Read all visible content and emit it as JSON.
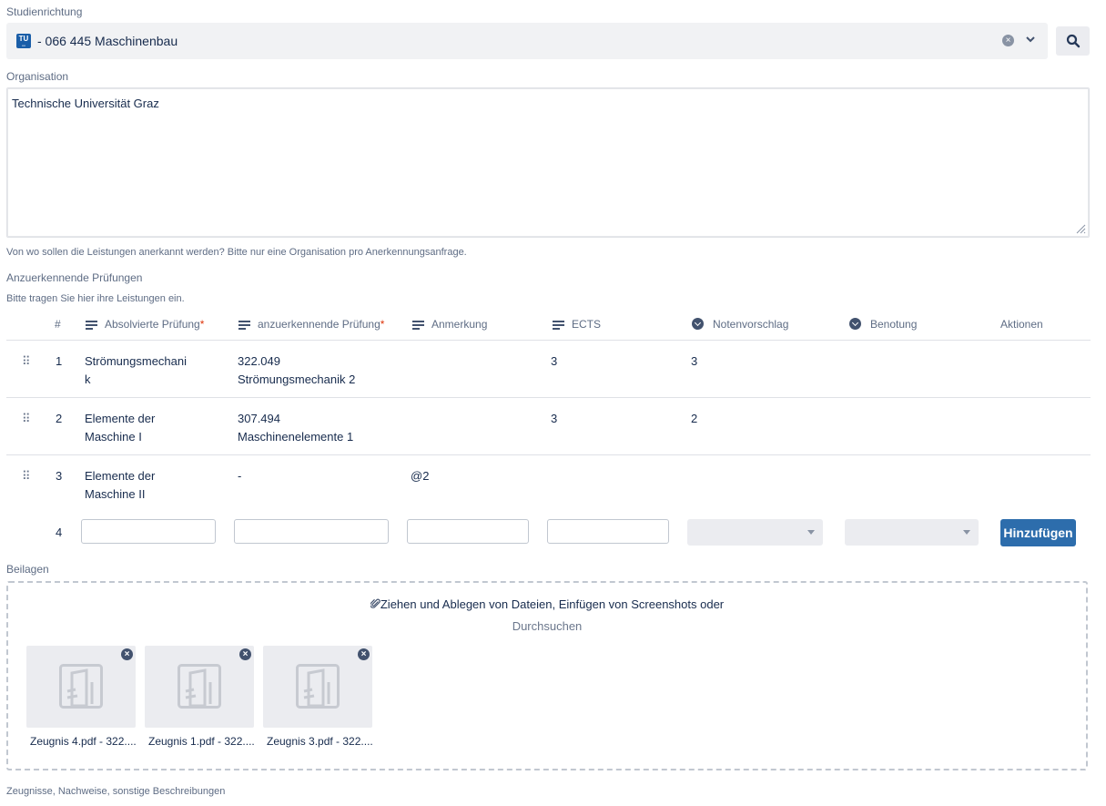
{
  "study": {
    "label": "Studienrichtung",
    "logo_text": "TU",
    "value": "- 066 445 Maschinenbau"
  },
  "organisation": {
    "label": "Organisation",
    "value": "Technische Universität Graz",
    "hint": "Von wo sollen die Leistungen anerkannt werden? Bitte nur eine Organisation pro Anerkennungsanfrage."
  },
  "exams": {
    "label": "Anzuerkennende Prüfungen",
    "hint": "Bitte tragen Sie hier ihre Leistungen ein.",
    "columns": {
      "num": "#",
      "absolved": "Absolvierte Prüfung",
      "recognized": "anzuerkennende Prüfung",
      "remark": "Anmerkung",
      "ects": "ECTS",
      "grade_suggestion": "Notenvorschlag",
      "grading": "Benotung",
      "actions": "Aktionen"
    },
    "required_marker": "*",
    "rows": [
      {
        "num": "1",
        "absolved_1": "Strömungsmechani",
        "absolved_2": "k",
        "rec_code": "322.049",
        "rec_name": "Strömungsmechanik 2",
        "remark": "",
        "ects": "3",
        "grade": "3"
      },
      {
        "num": "2",
        "absolved_1": "Elemente der",
        "absolved_2": "Maschine I",
        "rec_code": "307.494",
        "rec_name": "Maschinenelemente 1",
        "remark": "",
        "ects": "3",
        "grade": "2"
      },
      {
        "num": "3",
        "absolved_1": "Elemente der",
        "absolved_2": "Maschine II",
        "rec_code": "-",
        "rec_name": "",
        "remark": "@2",
        "ects": "",
        "grade": ""
      }
    ],
    "new_row_num": "4",
    "add_button": "Hinzufügen"
  },
  "attachments": {
    "label": "Beilagen",
    "drop_text": "Ziehen und Ablegen von Dateien, Einfügen von Screenshots oder",
    "browse": "Durchsuchen",
    "files": [
      {
        "name": "Zeugnis 4.pdf - 322...."
      },
      {
        "name": "Zeugnis 1.pdf - 322...."
      },
      {
        "name": "Zeugnis 3.pdf - 322...."
      }
    ],
    "hint": "Zeugnisse, Nachweise, sonstige Beschreibungen"
  },
  "colors": {
    "primary": "#2d6dac",
    "required": "#de350b",
    "logo": "#1a5ea8"
  }
}
